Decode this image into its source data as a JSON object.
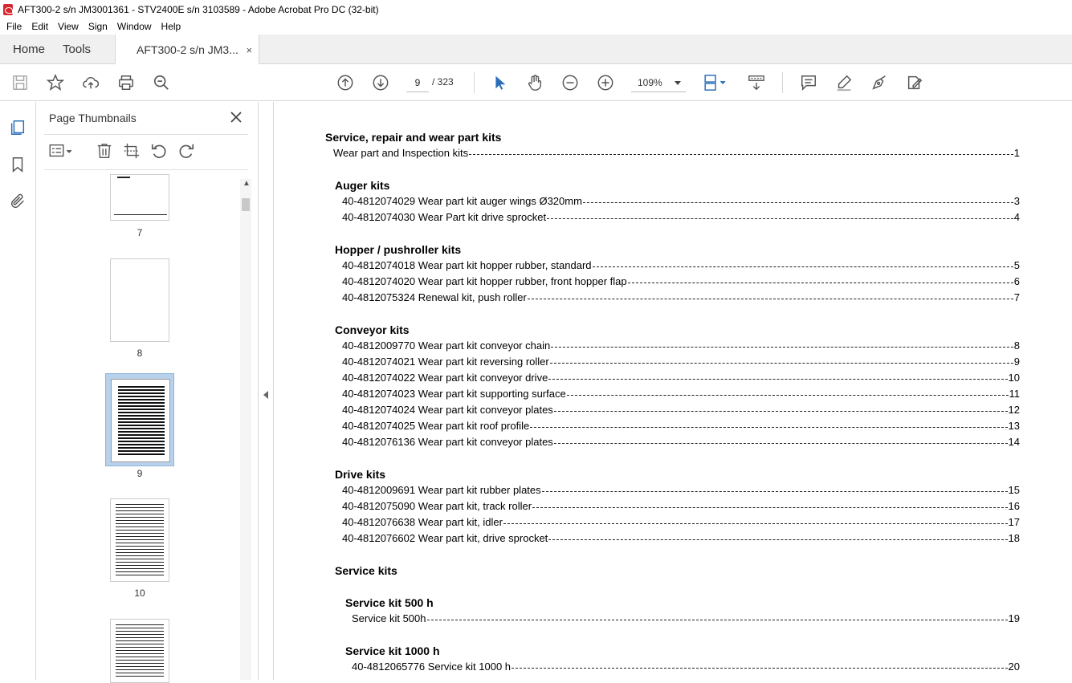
{
  "window": {
    "title": "AFT300-2  s/n JM3001361 - STV2400E s/n 3103589 - Adobe Acrobat Pro DC (32-bit)"
  },
  "menu": [
    "File",
    "Edit",
    "View",
    "Sign",
    "Window",
    "Help"
  ],
  "tabs": {
    "home": "Home",
    "tools": "Tools",
    "document": "AFT300-2  s/n JM3...",
    "close": "×"
  },
  "toolbar": {
    "current_page": "9",
    "total_pages": "/  323",
    "zoom": "109%"
  },
  "panel": {
    "title": "Page Thumbnails",
    "thumbnails": [
      "7",
      "8",
      "9",
      "10"
    ]
  },
  "doc": {
    "title": "Service, repair and wear part kits",
    "intro": {
      "label": "Wear part and Inspection kits",
      "page": "1"
    },
    "sections": [
      {
        "heading": "Auger kits",
        "entries": [
          {
            "label": "40-4812074029 Wear part kit auger wings Ø320mm",
            "page": "3"
          },
          {
            "label": "40-4812074030 Wear Part kit drive sprocket",
            "page": "4"
          }
        ]
      },
      {
        "heading": "Hopper / pushroller kits",
        "entries": [
          {
            "label": "40-4812074018 Wear part kit hopper rubber, standard",
            "page": "5"
          },
          {
            "label": "40-4812074020 Wear part kit hopper rubber, front hopper flap",
            "page": "6"
          },
          {
            "label": "40-4812075324 Renewal kit, push roller",
            "page": "7"
          }
        ]
      },
      {
        "heading": "Conveyor kits",
        "entries": [
          {
            "label": "40-4812009770 Wear part kit conveyor chain",
            "page": "8"
          },
          {
            "label": "40-4812074021 Wear part kit reversing roller",
            "page": "9"
          },
          {
            "label": "40-4812074022 Wear part kit conveyor drive",
            "page": "10"
          },
          {
            "label": "40-4812074023 Wear part kit supporting surface",
            "page": "11"
          },
          {
            "label": "40-4812074024 Wear part kit conveyor plates",
            "page": "12"
          },
          {
            "label": "40-4812074025 Wear part kit roof profile",
            "page": "13"
          },
          {
            "label": "40-4812076136 Wear part kit conveyor plates",
            "page": "14"
          }
        ]
      },
      {
        "heading": "Drive kits",
        "entries": [
          {
            "label": "40-4812009691 Wear part kit rubber plates",
            "page": "15"
          },
          {
            "label": "40-4812075090 Wear part kit, track roller",
            "page": "16"
          },
          {
            "label": "40-4812076638 Wear part kit, idler",
            "page": "17"
          },
          {
            "label": "40-4812076602 Wear part kit, drive sprocket",
            "page": "18"
          }
        ]
      },
      {
        "heading": "Service kits",
        "entries": []
      }
    ],
    "subsections": [
      {
        "heading": "Service kit 500 h",
        "entries": [
          {
            "label": "Service kit 500h",
            "page": "19"
          }
        ]
      },
      {
        "heading": "Service kit 1000 h",
        "entries": [
          {
            "label": "40-4812065776 Service kit 1000 h",
            "page": "20"
          }
        ]
      }
    ]
  }
}
